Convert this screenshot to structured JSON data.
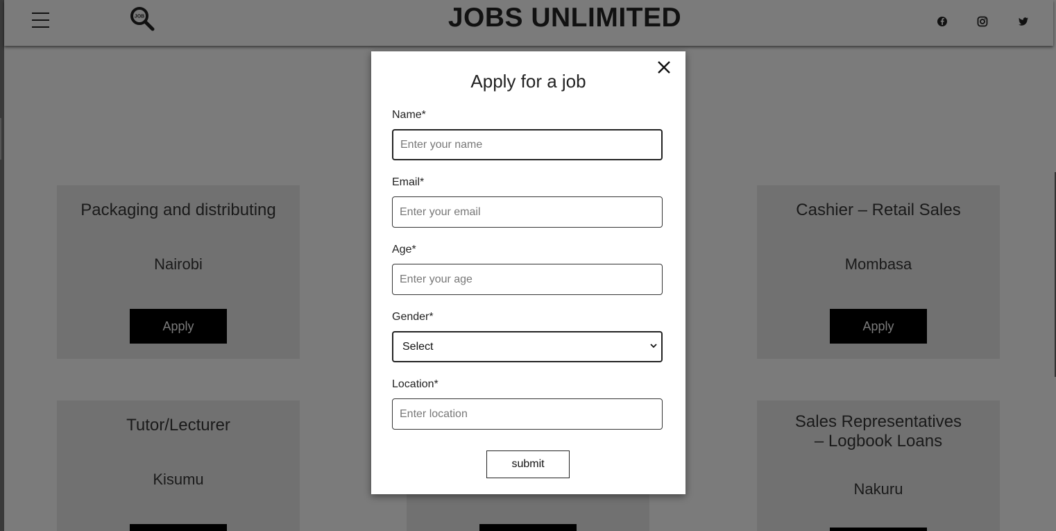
{
  "header": {
    "brand": "JOBS UNLIMITED",
    "logo_text": "JOB",
    "menu_icon": "hamburger-menu-icon",
    "search_icon": "magnifier-job-logo-icon",
    "social_icons": [
      "facebook-icon",
      "instagram-icon",
      "twitter-icon"
    ]
  },
  "jobs": [
    {
      "title": "Packaging and distributing",
      "location": "Nairobi",
      "button": "Apply"
    },
    {
      "title": "Cashier – Retail Sales",
      "location": "Mombasa",
      "button": "Apply"
    },
    {
      "title": "Tutor/Lecturer",
      "location": "Kisumu",
      "button": "Apply"
    },
    {
      "title_line1": "Sales Representatives",
      "title_line2": "– Logbook Loans",
      "location": "Nakuru",
      "button": "Apply"
    }
  ],
  "modal": {
    "title": "Apply for a job",
    "close_icon": "close-x-icon",
    "fields": {
      "name": {
        "label": "Name*",
        "placeholder": "Enter your name",
        "value": ""
      },
      "email": {
        "label": "Email*",
        "placeholder": "Enter your email",
        "value": ""
      },
      "age": {
        "label": "Age*",
        "placeholder": "Enter your age",
        "value": ""
      },
      "gender": {
        "label": "Gender*",
        "selected": "Select"
      },
      "location": {
        "label": "Location*",
        "placeholder": "Enter location",
        "value": ""
      }
    },
    "submit_label": "submit"
  },
  "colors": {
    "page_overlay": "#7b7b7b",
    "card": "#717171",
    "button": "#000000",
    "modal": "#ffffff"
  }
}
